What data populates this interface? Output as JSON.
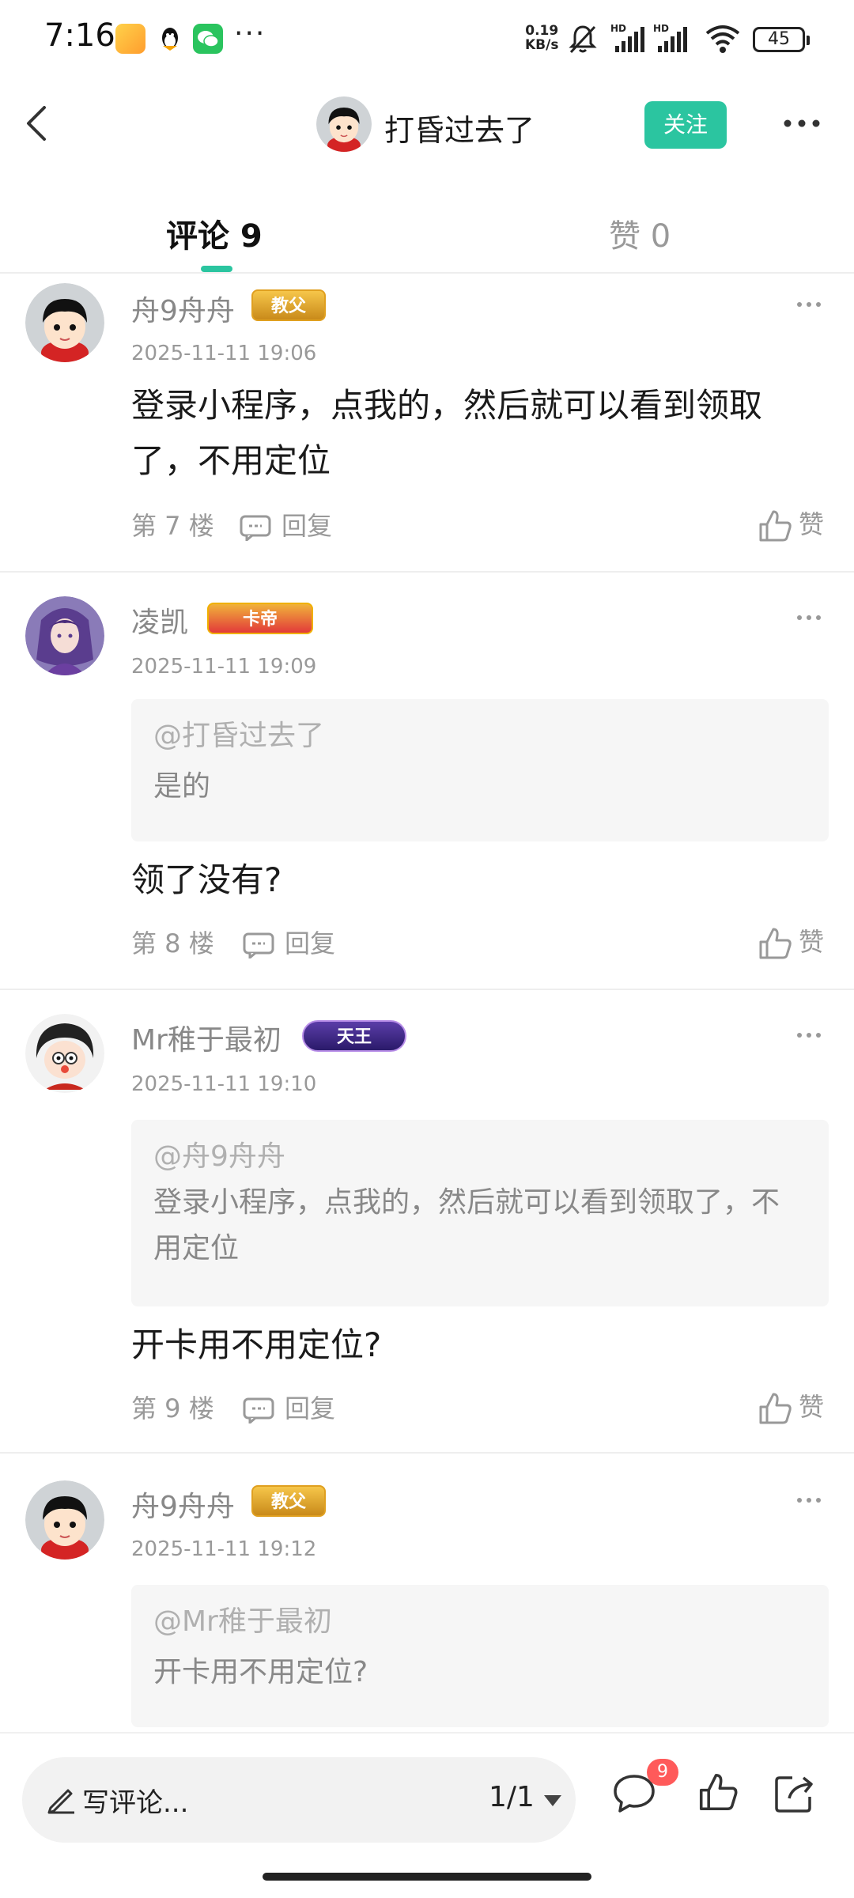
{
  "status_bar": {
    "time": "7:16",
    "net_speed_value": "0.19",
    "net_speed_unit": "KB/s",
    "battery": "45"
  },
  "header": {
    "title": "打昏过去了",
    "follow_label": "关注"
  },
  "tabs": {
    "comments_label": "评论 9",
    "likes_label": "赞 0"
  },
  "comments": [
    {
      "username": "舟9舟舟",
      "badge": "教父",
      "time": "2025-11-11 19:06",
      "text": "登录小程序，点我的，然后就可以看到领取了，不用定位",
      "floor": "第 7 楼",
      "reply_label": "回复",
      "like_label": "赞"
    },
    {
      "username": "凌凯",
      "badge": "卡帝",
      "time": "2025-11-11 19:09",
      "quote_at": "@打昏过去了",
      "quote_text": "是的",
      "text": "领了没有?",
      "floor": "第 8 楼",
      "reply_label": "回复",
      "like_label": "赞"
    },
    {
      "username": "Mr稚于最初",
      "badge": "天王",
      "time": "2025-11-11 19:10",
      "quote_at": "@舟9舟舟",
      "quote_text": "登录小程序，点我的，然后就可以看到领取了，不用定位",
      "text": "开卡用不用定位?",
      "floor": "第 9 楼",
      "reply_label": "回复",
      "like_label": "赞"
    },
    {
      "username": "舟9舟舟",
      "badge": "教父",
      "time": "2025-11-11 19:12",
      "quote_at": "@Mr稚于最初",
      "quote_text": "开卡用不用定位?"
    }
  ],
  "bottom_bar": {
    "input_placeholder": "写评论...",
    "pager": "1/1",
    "comment_count": "9"
  },
  "colors": {
    "accent": "#2bc5a0",
    "badge_red": "#ff5a5a"
  }
}
